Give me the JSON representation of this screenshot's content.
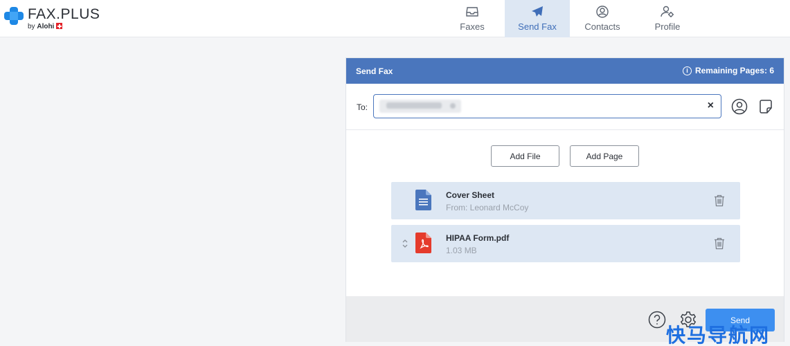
{
  "brand": {
    "name": "FAX.PLUS",
    "by": "by",
    "company": "Alohi",
    "logo_color": "#1e88e5"
  },
  "nav": [
    {
      "label": "Faxes",
      "icon": "inbox-icon",
      "active": false
    },
    {
      "label": "Send Fax",
      "icon": "paper-plane-icon",
      "active": true
    },
    {
      "label": "Contacts",
      "icon": "user-circle-icon",
      "active": false
    },
    {
      "label": "Profile",
      "icon": "user-settings-icon",
      "active": false
    }
  ],
  "panel": {
    "title": "Send Fax",
    "remaining_pages": "Remaining Pages: 6",
    "to_label": "To:",
    "clear_symbol": "×"
  },
  "actions": {
    "add_file": "Add File",
    "add_page": "Add Page"
  },
  "files": [
    {
      "name": "Cover Sheet",
      "sub": "From: Leonard McCoy",
      "type": "document-icon"
    },
    {
      "name": "HIPAA Form.pdf",
      "sub": "1.03 MB",
      "type": "pdf-icon"
    }
  ],
  "footer": {
    "send_label": "Send"
  },
  "watermark": "快马导航网",
  "colors": {
    "header": "#4a76bd",
    "active_tab": "#dde7f3",
    "send_button": "#3d8ff0",
    "pdf_red": "#e53b2c",
    "doc_blue": "#4a76bd"
  }
}
